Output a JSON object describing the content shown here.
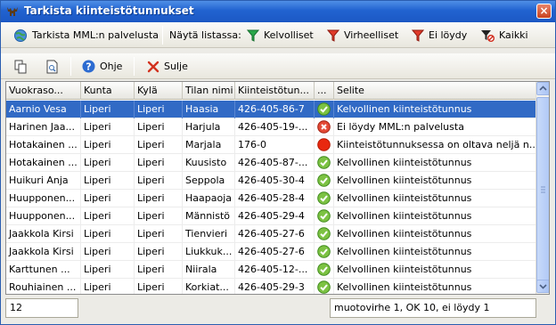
{
  "window": {
    "title": "Tarkista kiinteistötunnukset",
    "close_label": "×"
  },
  "toolbar1": {
    "check_label": "Tarkista MML:n palvelusta",
    "show_label": "Näytä listassa:",
    "filters": [
      {
        "label": "Kelvolliset",
        "color": "#2aa84a"
      },
      {
        "label": "Virheelliset",
        "color": "#e03a2a"
      },
      {
        "label": "Ei löydy",
        "color": "#e03a2a"
      },
      {
        "label": "Kaikki",
        "color": "#222222"
      }
    ]
  },
  "toolbar2": {
    "help_label": "Ohje",
    "close_label": "Sulje"
  },
  "table": {
    "columns": [
      "Vuokraso...",
      "Kunta",
      "Kylä",
      "Tilan nimi",
      "Kiinteistötun...",
      "...",
      "Selite"
    ],
    "rows": [
      {
        "vuokraso": "Aarnio Vesa",
        "kunta": "Liperi",
        "kyla": "Liperi",
        "tila": "Haasia",
        "tunnus": "426-405-86-7",
        "status": "ok",
        "selite": "Kelvollinen kiinteistötunnus"
      },
      {
        "vuokraso": "Harinen Jaa...",
        "kunta": "Liperi",
        "kyla": "Liperi",
        "tila": "Harjula",
        "tunnus": "426-405-19-...",
        "status": "notfound",
        "selite": "Ei löydy MML:n palvelusta"
      },
      {
        "vuokraso": "Hotakainen ...",
        "kunta": "Liperi",
        "kyla": "Liperi",
        "tila": "Marjala",
        "tunnus": "176-0",
        "status": "error",
        "selite": "Kiinteistötunnuksessa on oltava neljä n..."
      },
      {
        "vuokraso": "Hotakainen ...",
        "kunta": "Liperi",
        "kyla": "Liperi",
        "tila": "Kuusisto",
        "tunnus": "426-405-87-...",
        "status": "ok",
        "selite": "Kelvollinen kiinteistötunnus"
      },
      {
        "vuokraso": "Huikuri Anja",
        "kunta": "Liperi",
        "kyla": "Liperi",
        "tila": "Seppola",
        "tunnus": "426-405-30-4",
        "status": "ok",
        "selite": "Kelvollinen kiinteistötunnus"
      },
      {
        "vuokraso": "Huupponen...",
        "kunta": "Liperi",
        "kyla": "Liperi",
        "tila": "Haapaoja",
        "tunnus": "426-405-28-4",
        "status": "ok",
        "selite": "Kelvollinen kiinteistötunnus"
      },
      {
        "vuokraso": "Huupponen...",
        "kunta": "Liperi",
        "kyla": "Liperi",
        "tila": "Männistö",
        "tunnus": "426-405-29-4",
        "status": "ok",
        "selite": "Kelvollinen kiinteistötunnus"
      },
      {
        "vuokraso": "Jaakkola Kirsi",
        "kunta": "Liperi",
        "kyla": "Liperi",
        "tila": "Tienvieri",
        "tunnus": "426-405-27-6",
        "status": "ok",
        "selite": "Kelvollinen kiinteistötunnus"
      },
      {
        "vuokraso": "Jaakkola Kirsi",
        "kunta": "Liperi",
        "kyla": "Liperi",
        "tila": "Liukkuk...",
        "tunnus": "426-405-27-6",
        "status": "ok",
        "selite": "Kelvollinen kiinteistötunnus"
      },
      {
        "vuokraso": "Karttunen ...",
        "kunta": "Liperi",
        "kyla": "Liperi",
        "tila": "Niirala",
        "tunnus": "426-405-12-...",
        "status": "ok",
        "selite": "Kelvollinen kiinteistötunnus"
      },
      {
        "vuokraso": "Rouhiainen ...",
        "kunta": "Liperi",
        "kyla": "Liperi",
        "tila": "Korkiat...",
        "tunnus": "426-405-29-3",
        "status": "ok",
        "selite": "Kelvollinen kiinteistötunnus"
      }
    ],
    "selected_row": 0
  },
  "footer": {
    "count": "12",
    "summary": "muotovirhe 1,  OK 10, ei löydy 1"
  }
}
